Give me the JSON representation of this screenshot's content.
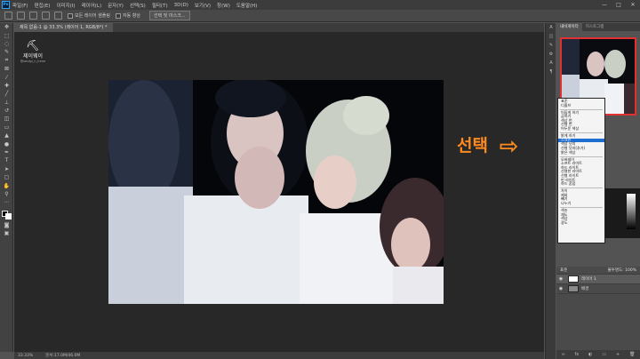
{
  "app": {
    "logo": "Ps"
  },
  "menu": [
    "파일(F)",
    "편집(E)",
    "이미지(I)",
    "레이어(L)",
    "문자(Y)",
    "선택(S)",
    "필터(T)",
    "3D(D)",
    "보기(V)",
    "창(W)",
    "도움말(H)"
  ],
  "window_controls": [
    "—",
    "□",
    "✕"
  ],
  "options": {
    "sample_all_layers": "모든 레이어 샘플링",
    "auto_enhance": "자동 향상",
    "select_mask_button": "선택 및 마스크..."
  },
  "document": {
    "tab_title": "제목 없음-1 @ 33.3% (레이어 1, RGB/8*) *"
  },
  "watermark": {
    "logo": "⛏",
    "name": "제이웨이",
    "sub": "@seulgi_n_irene"
  },
  "status": {
    "zoom": "33.33%",
    "doc_info": "문서:17.0M/46.0M"
  },
  "panel": {
    "tabs": [
      "내비게이터",
      "히스토그램"
    ],
    "layers": {
      "blend_label": "표준",
      "opacity_label": "불투명도: 100%",
      "items": [
        {
          "name": "레이어 1"
        },
        {
          "name": "배경"
        }
      ]
    }
  },
  "blend_modes": {
    "groups": [
      [
        "표준",
        "디졸브"
      ],
      [
        "어둡게 하기",
        "곱하기",
        "색상 번",
        "선형 번",
        "어두운 색상"
      ],
      [
        "밝게 하기",
        "스크린",
        "색상 닷지",
        "선형 닷지(추가)",
        "밝은 색상"
      ],
      [
        "오버레이",
        "소프트 라이트",
        "하드 라이트",
        "선명한 라이트",
        "선형 라이트",
        "핀 라이트",
        "하드 혼합"
      ],
      [
        "차이",
        "제외",
        "빼기",
        "나누기"
      ],
      [
        "색조",
        "채도",
        "색상",
        "광도"
      ]
    ],
    "highlighted": "스크린"
  },
  "callout": {
    "text": "선택",
    "arrow": "⇨"
  },
  "colors": {
    "accent": "#ff8a1e",
    "highlight": "#1f6fd1",
    "nav_border": "#e03030"
  },
  "icons": [
    "move-icon",
    "marquee-icon",
    "lasso-icon",
    "quick-select-icon",
    "crop-icon",
    "eyedropper-icon",
    "healing-icon",
    "brush-icon",
    "stamp-icon",
    "history-brush-icon",
    "eraser-icon",
    "gradient-icon",
    "blur-icon",
    "dodge-icon",
    "pen-icon",
    "type-icon",
    "path-select-icon",
    "shape-icon",
    "hand-icon",
    "zoom-icon"
  ]
}
